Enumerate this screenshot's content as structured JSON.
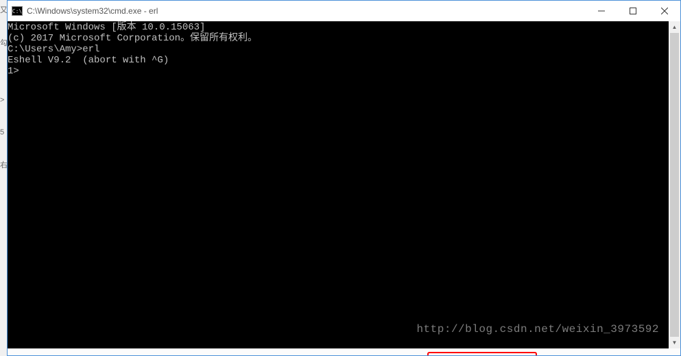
{
  "window": {
    "title": "C:\\Windows\\system32\\cmd.exe - erl",
    "icon_text": "C:\\"
  },
  "terminal": {
    "line1": "Microsoft Windows [版本 10.0.15063]",
    "line2": "(c) 2017 Microsoft Corporation。保留所有权利。",
    "line3": "",
    "line4": "C:\\Users\\Amy>erl",
    "line5": "Eshell V9.2  (abort with ^G)",
    "line6": "1>"
  },
  "watermark": "http://blog.csdn.net/weixin_3973592",
  "edge": {
    "m1": "又",
    "m2": "勾",
    "m3": "5",
    "m4": "右",
    "m5": ">"
  }
}
